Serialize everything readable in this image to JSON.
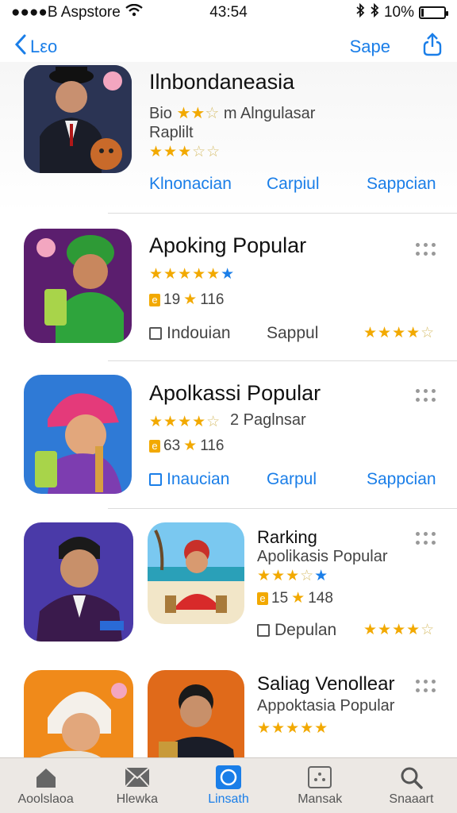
{
  "status_bar": {
    "carrier": "●●●●B Aspstore",
    "time": "43:54",
    "battery_text": "10%"
  },
  "nav": {
    "back_label": "Lεo",
    "save_label": "Sape"
  },
  "featured": {
    "title": "Ilnbondaneasia",
    "subtitle_prefix": "Bio",
    "subtitle_suffix": "m Alngulasar",
    "line2": "Raplilt",
    "actions": [
      "Klnonacian",
      "Carpiul",
      "Sappcian"
    ]
  },
  "apps": [
    {
      "title": "Apoking Popular",
      "rating_text": "19",
      "count": "116",
      "left_label": "Indouian",
      "mid_label": "Sappul"
    },
    {
      "title": "Apolkassi Popular",
      "subtitle": "2 Paglnsar",
      "rating_text": "63",
      "count": "116",
      "actions": [
        "Inaucian",
        "Garpul",
        "Sappcian"
      ]
    },
    {
      "title": "Rarking",
      "subtitle": "Apolikasis Popular",
      "rating_text": "15",
      "count": "148",
      "left_label": "Depulan"
    },
    {
      "title": "Saliag Venollear",
      "subtitle": "Appoktasia Popular"
    }
  ],
  "tabs": [
    {
      "label": "Aoolslaoa"
    },
    {
      "label": "Hlewka"
    },
    {
      "label": "Linsath"
    },
    {
      "label": "Mansak"
    },
    {
      "label": "Snaaart"
    }
  ],
  "colors": {
    "accent": "#1a7ee8",
    "star": "#f2a900",
    "tabbar": "#ece8e4"
  }
}
